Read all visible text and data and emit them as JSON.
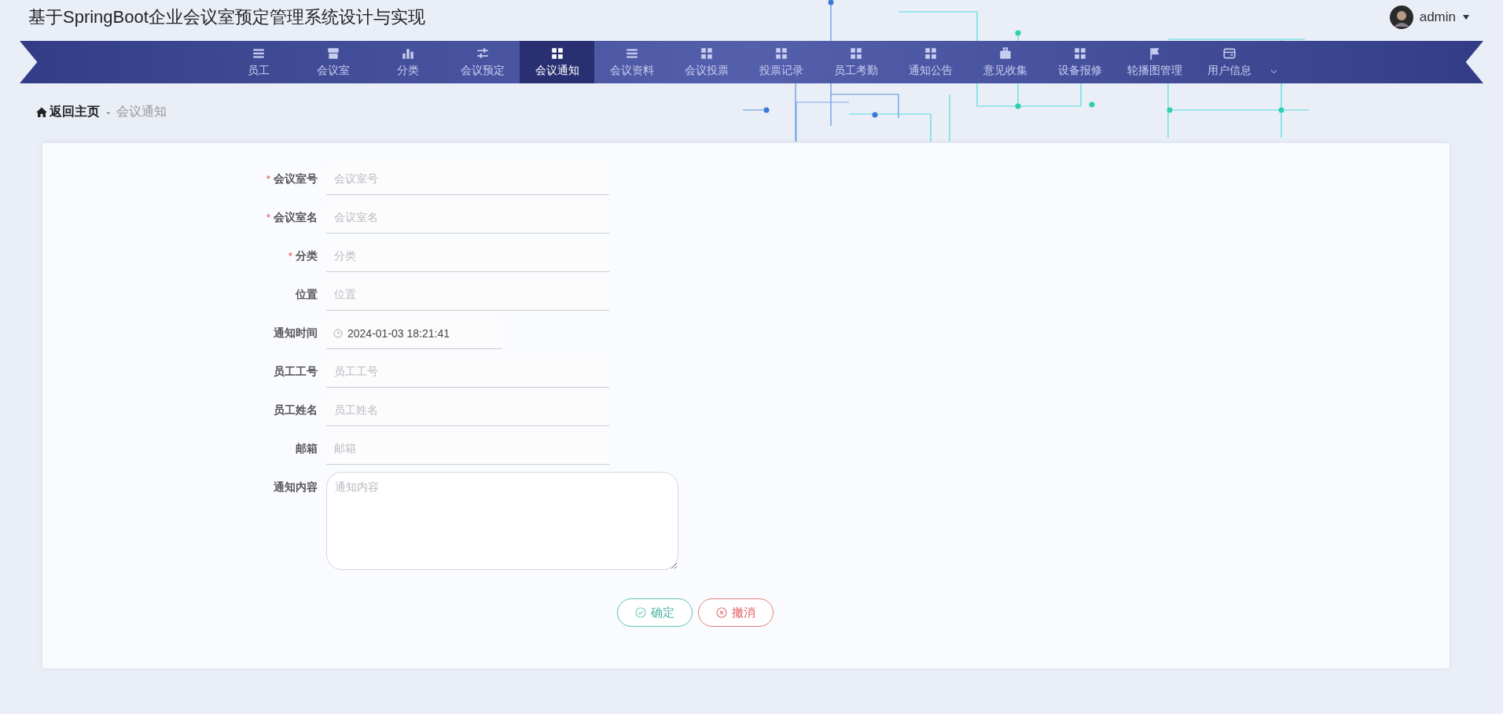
{
  "header": {
    "title": "基于SpringBoot企业会议室预定管理系统设计与实现",
    "user": "admin"
  },
  "nav": [
    {
      "label": "员工",
      "selected": false,
      "dropdown": false
    },
    {
      "label": "会议室",
      "selected": false,
      "dropdown": false
    },
    {
      "label": "分类",
      "selected": false,
      "dropdown": false
    },
    {
      "label": "会议预定",
      "selected": false,
      "dropdown": false
    },
    {
      "label": "会议通知",
      "selected": true,
      "dropdown": false
    },
    {
      "label": "会议资料",
      "selected": false,
      "dropdown": false
    },
    {
      "label": "会议投票",
      "selected": false,
      "dropdown": false
    },
    {
      "label": "投票记录",
      "selected": false,
      "dropdown": false
    },
    {
      "label": "员工考勤",
      "selected": false,
      "dropdown": false
    },
    {
      "label": "通知公告",
      "selected": false,
      "dropdown": false
    },
    {
      "label": "意见收集",
      "selected": false,
      "dropdown": false
    },
    {
      "label": "设备报修",
      "selected": false,
      "dropdown": false
    },
    {
      "label": "轮播图管理",
      "selected": false,
      "dropdown": false
    },
    {
      "label": "用户信息",
      "selected": false,
      "dropdown": true
    }
  ],
  "breadcrumb": {
    "home": "返回主页",
    "separator": "-",
    "current": "会议通知"
  },
  "form": {
    "fields": [
      {
        "kind": "text",
        "label": "会议室号",
        "required": true,
        "placeholder": "会议室号"
      },
      {
        "kind": "text",
        "label": "会议室名",
        "required": true,
        "placeholder": "会议室名"
      },
      {
        "kind": "text",
        "label": "分类",
        "required": true,
        "placeholder": "分类"
      },
      {
        "kind": "text",
        "label": "位置",
        "required": false,
        "placeholder": "位置"
      },
      {
        "kind": "date",
        "label": "通知时间",
        "required": false,
        "value": "2024-01-03 18:21:41"
      },
      {
        "kind": "text",
        "label": "员工工号",
        "required": false,
        "placeholder": "员工工号"
      },
      {
        "kind": "text",
        "label": "员工姓名",
        "required": false,
        "placeholder": "员工姓名"
      },
      {
        "kind": "text",
        "label": "邮箱",
        "required": false,
        "placeholder": "邮箱"
      },
      {
        "kind": "textarea",
        "label": "通知内容",
        "required": false,
        "placeholder": "通知内容"
      }
    ],
    "required_mark": "*",
    "buttons": [
      {
        "kind": "confirm",
        "label": "确定"
      },
      {
        "kind": "cancel",
        "label": "撤消"
      }
    ]
  }
}
